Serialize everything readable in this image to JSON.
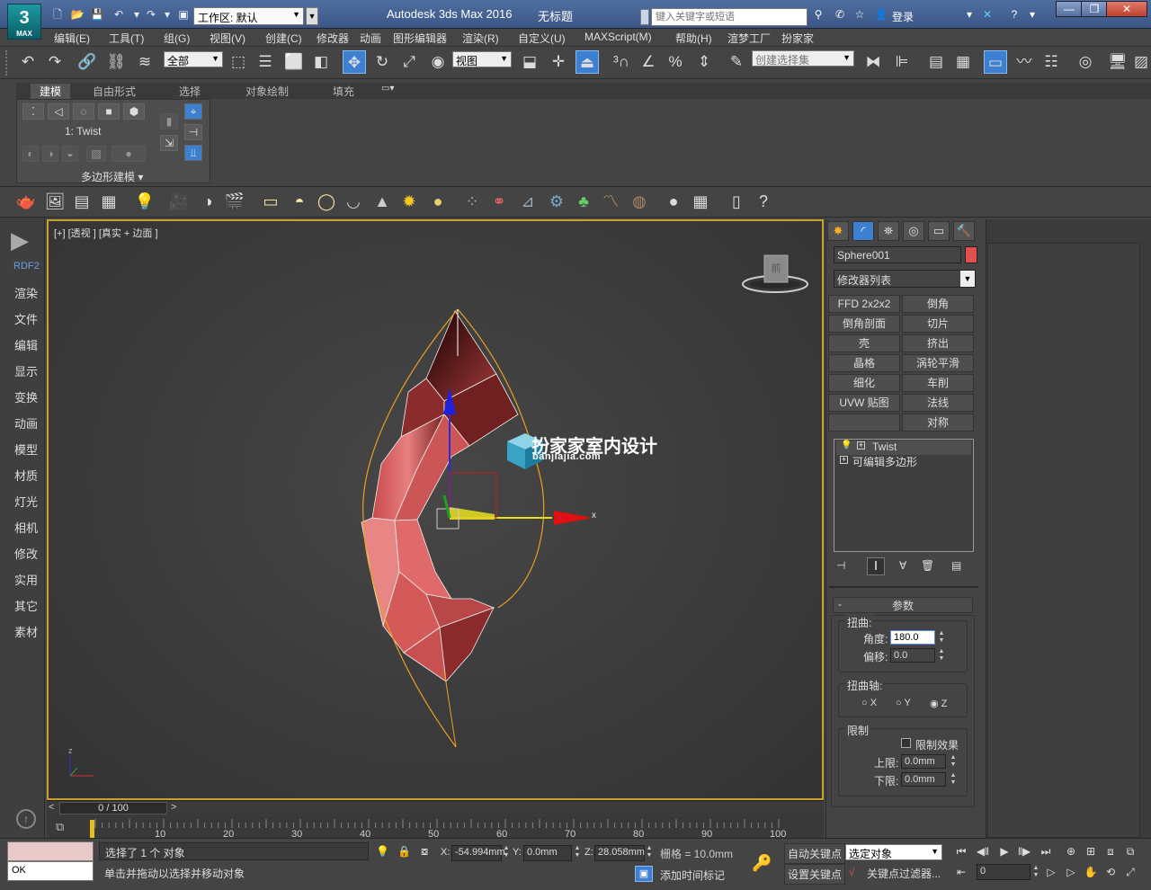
{
  "title_bar": {
    "app_title": "Autodesk 3ds Max 2016",
    "doc_title": "无标题",
    "logo_text": "3",
    "logo_sub": "MAX",
    "workspace": "工作区: 默认",
    "search_placeholder": "键入关键字或短语",
    "login": "登录"
  },
  "menu": [
    "编辑(E)",
    "工具(T)",
    "组(G)",
    "视图(V)",
    "创建(C)",
    "修改器",
    "动画",
    "图形编辑器",
    "渲染(R)",
    "自定义(U)",
    "MAXScript(M)",
    "帮助(H)",
    "渲梦工厂",
    "扮家家"
  ],
  "toolbar": {
    "selection_filter": "全部",
    "ref_coord": "视图",
    "named_selection": "创建选择集"
  },
  "ribbon": {
    "tabs": [
      "建模",
      "自由形式",
      "选择",
      "对象绘制",
      "填充"
    ],
    "selected_tab": "建模",
    "modifier_label": "1: Twist",
    "panel_label": "多边形建模 ▾"
  },
  "left_sidebar": {
    "logo_text": "RDF2",
    "items": [
      "渲染",
      "文件",
      "编辑",
      "显示",
      "变换",
      "动画",
      "模型",
      "材质",
      "灯光",
      "相机",
      "修改",
      "实用",
      "其它",
      "素材"
    ]
  },
  "viewport": {
    "label": "[+] [透视 ] [真实 + 边面 ]",
    "gizmo_x": "x",
    "axis_z": "z",
    "viewcube_label": "前",
    "watermark_text": "扮家家室内设计",
    "watermark_url": "banjiajia.com"
  },
  "timeline": {
    "slider_text": "0 / 100",
    "ticks": [
      "10",
      "20",
      "30",
      "40",
      "50",
      "60",
      "70",
      "80",
      "90",
      "100"
    ]
  },
  "command_panel": {
    "object_name": "Sphere001",
    "object_color": "#e05050",
    "modifier_list": "修改器列表",
    "modifier_buttons": [
      "FFD 2x2x2",
      "倒角",
      "倒角剖面",
      "切片",
      "壳",
      "挤出",
      "晶格",
      "涡轮平滑",
      "细化",
      "车削",
      "UVW 贴图",
      "法线",
      "",
      "对称"
    ],
    "stack": [
      "Twist",
      "可编辑多边形"
    ],
    "rollout_title": "参数",
    "twist_group": "扭曲:",
    "angle_label": "角度:",
    "angle_value": "180.0",
    "bias_label": "偏移:",
    "bias_value": "0.0",
    "axis_group": "扭曲轴:",
    "axis_options": [
      "X",
      "Y",
      "Z"
    ],
    "axis_selected": "Z",
    "limits_group": "限制",
    "limit_effect": "限制效果",
    "upper_label": "上限:",
    "upper_value": "0.0mm",
    "lower_label": "下限:",
    "lower_value": "0.0mm"
  },
  "status_bar": {
    "maxscript_value": "OK",
    "selection_info": "选择了 1 个 对象",
    "prompt": "单击并拖动以选择并移动对象",
    "x_label": "X:",
    "x_value": "-54.994mm",
    "y_label": "Y:",
    "y_value": "0.0mm",
    "z_label": "Z:",
    "z_value": "28.058mm",
    "grid": "栅格 = 10.0mm",
    "add_time_tag": "添加时间标记",
    "auto_key": "自动关键点",
    "set_key": "设置关键点",
    "selected_object": "选定对象",
    "key_filters": "关键点过滤器...",
    "frame": "0"
  },
  "colors": {
    "accent": "#3d7fd1",
    "viewport_border": "#c9a22a",
    "object": "#e05050"
  }
}
